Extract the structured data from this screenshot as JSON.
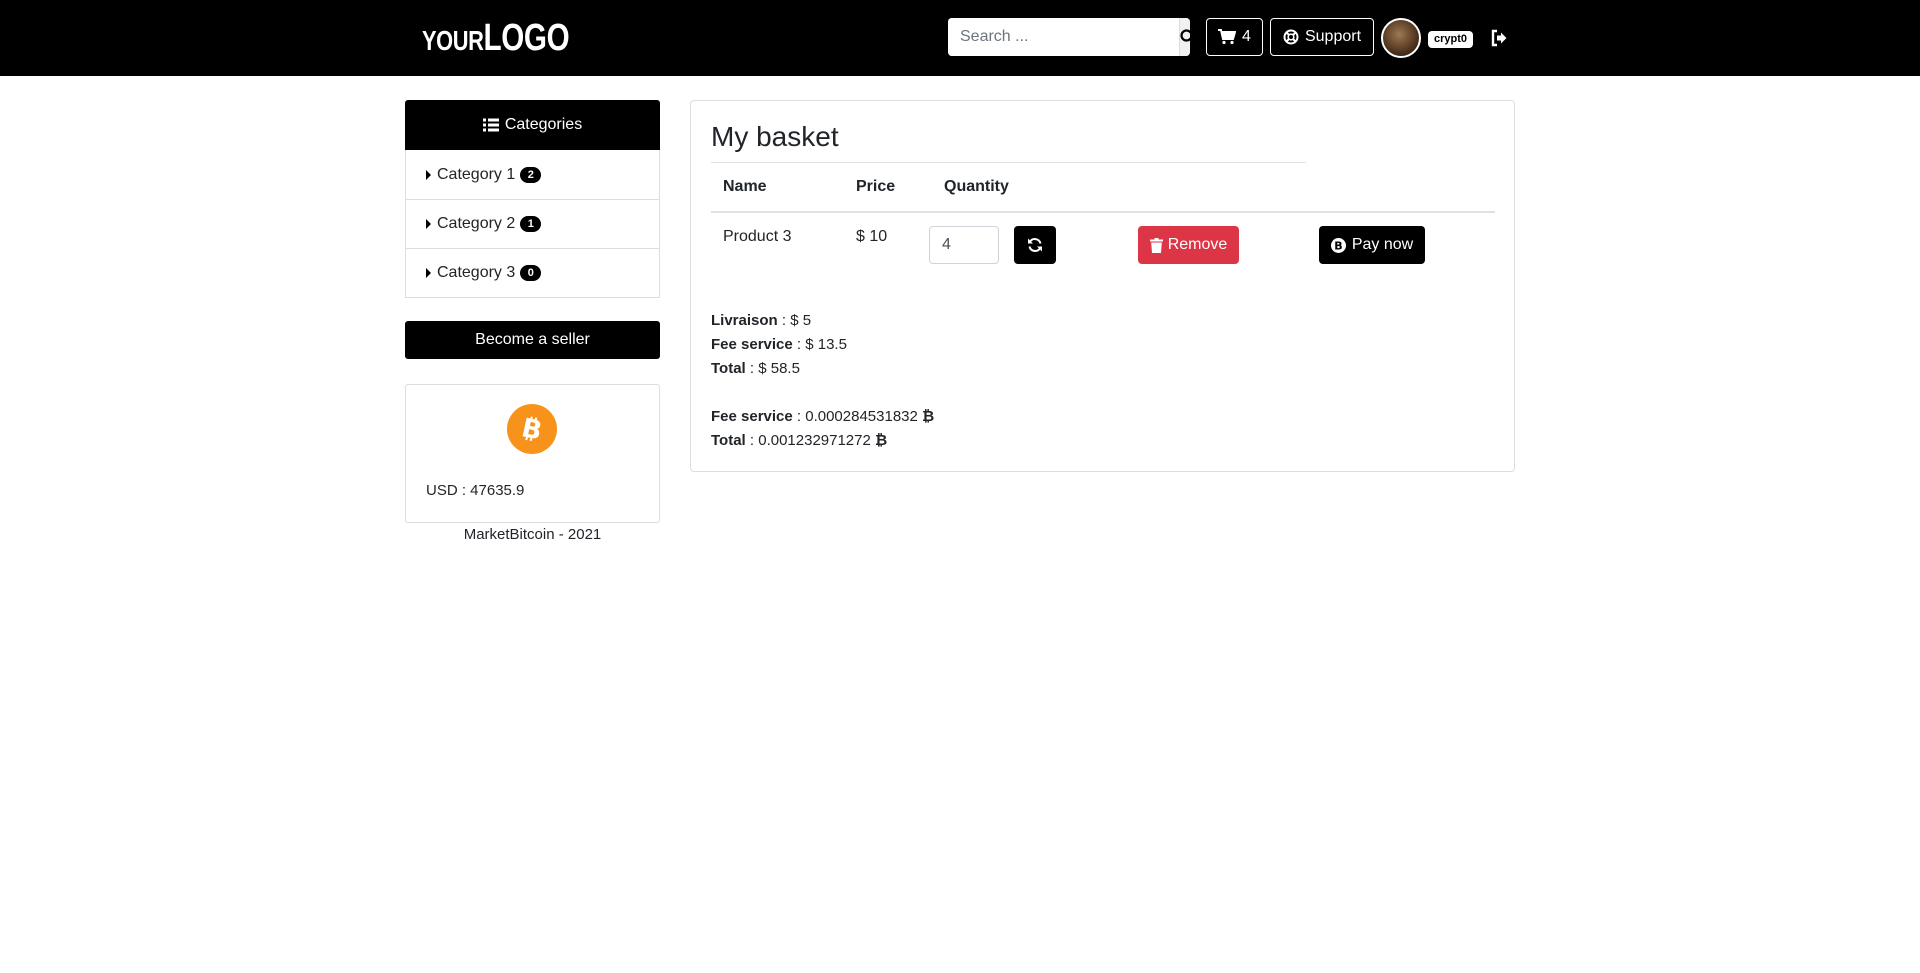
{
  "header": {
    "logo_small": "YOUR",
    "logo_big": "LOGO",
    "search_placeholder": "Search ...",
    "cart_count": "4",
    "support_label": "Support",
    "username": "crypt0"
  },
  "sidebar": {
    "categories_title": "Categories",
    "categories": [
      {
        "label": "Category 1",
        "count": "2"
      },
      {
        "label": "Category 2",
        "count": "1"
      },
      {
        "label": "Category 3",
        "count": "0"
      }
    ],
    "seller_button": "Become a seller",
    "usd_label": "USD : 47635.9",
    "footer": "MarketBitcoin - 2021"
  },
  "basket": {
    "title": "My basket",
    "columns": [
      "Name",
      "Price",
      "Quantity"
    ],
    "rows": [
      {
        "name": "Product 3",
        "price": "$ 10",
        "quantity": "4"
      }
    ],
    "remove_label": "Remove",
    "pay_label": "Pay now",
    "summary_usd": [
      {
        "label": "Livraison",
        "value": " : $ 5"
      },
      {
        "label": "Fee service",
        "value": " : $ 13.5"
      },
      {
        "label": "Total",
        "value": " : $ 58.5"
      }
    ],
    "summary_btc": [
      {
        "label": "Fee service",
        "value": " : 0.000284531832 "
      },
      {
        "label": "Total",
        "value": " : 0.001232971272 "
      }
    ],
    "btc_symbol": "₿"
  },
  "colors": {
    "navbar": "#000000",
    "danger": "#dc3545",
    "bitcoin": "#f7931a"
  }
}
